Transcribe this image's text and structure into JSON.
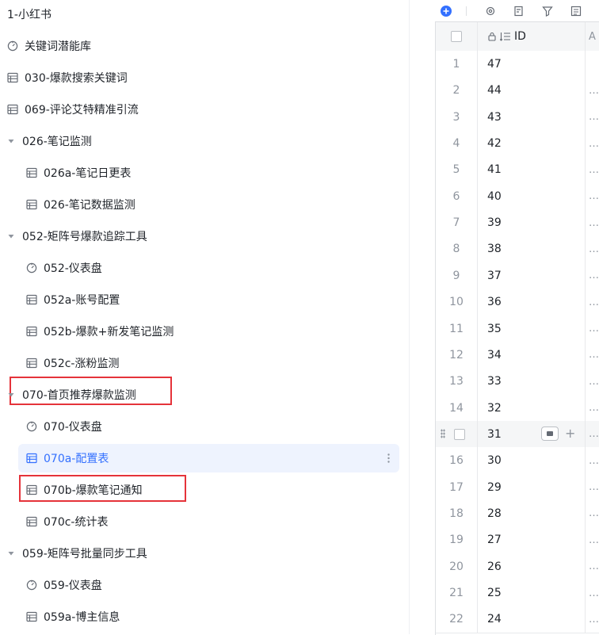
{
  "colors": {
    "accent": "#3370ff",
    "annotation_red": "#e5333a",
    "selected_bg": "#eef3fe"
  },
  "sidebar": {
    "rows": [
      {
        "label": "1-小红书",
        "icon": "none",
        "level": 0
      },
      {
        "label": "关键词潜能库",
        "icon": "dashboard-icon",
        "level": 0
      },
      {
        "label": "030-爆款搜索关键词",
        "icon": "table-icon",
        "level": 0
      },
      {
        "label": "069-评论艾特精准引流",
        "icon": "table-icon",
        "level": 0
      },
      {
        "label": "026-笔记监测",
        "icon": "folder-expanded",
        "level": 0
      },
      {
        "label": "026a-笔记日更表",
        "icon": "table-icon",
        "level": 1
      },
      {
        "label": "026-笔记数据监测",
        "icon": "table-icon",
        "level": 1
      },
      {
        "label": "052-矩阵号爆款追踪工具",
        "icon": "folder-expanded",
        "level": 0
      },
      {
        "label": "052-仪表盘",
        "icon": "dashboard-icon",
        "level": 1
      },
      {
        "label": "052a-账号配置",
        "icon": "table-icon",
        "level": 1
      },
      {
        "label": "052b-爆款+新发笔记监测",
        "icon": "table-icon",
        "level": 1
      },
      {
        "label": "052c-涨粉监测",
        "icon": "table-icon",
        "level": 1
      },
      {
        "label": "070-首页推荐爆款监测",
        "icon": "folder-expanded",
        "level": 0
      },
      {
        "label": "070-仪表盘",
        "icon": "dashboard-icon",
        "level": 1
      },
      {
        "label": "070a-配置表",
        "icon": "table-icon",
        "level": 1,
        "selected": true
      },
      {
        "label": "070b-爆款笔记通知",
        "icon": "table-icon",
        "level": 1
      },
      {
        "label": "070c-统计表",
        "icon": "table-icon",
        "level": 1
      },
      {
        "label": "059-矩阵号批量同步工具",
        "icon": "folder-expanded",
        "level": 0
      },
      {
        "label": "059-仪表盘",
        "icon": "dashboard-icon",
        "level": 1
      },
      {
        "label": "059a-博主信息",
        "icon": "table-icon",
        "level": 1
      }
    ]
  },
  "toolbar": {
    "icons": [
      "add-circle-icon",
      "settings-icon",
      "form-icon",
      "filter-icon",
      "list-icon"
    ]
  },
  "grid": {
    "header": {
      "id_label": "ID",
      "next_col_partial": "A"
    },
    "rows": [
      {
        "index": "1",
        "id": "47",
        "next": ""
      },
      {
        "index": "2",
        "id": "44",
        "next": "…"
      },
      {
        "index": "3",
        "id": "43",
        "next": "…"
      },
      {
        "index": "4",
        "id": "42",
        "next": "…"
      },
      {
        "index": "5",
        "id": "41",
        "next": "…"
      },
      {
        "index": "6",
        "id": "40",
        "next": "…"
      },
      {
        "index": "7",
        "id": "39",
        "next": "…"
      },
      {
        "index": "8",
        "id": "38",
        "next": "…"
      },
      {
        "index": "9",
        "id": "37",
        "next": "…"
      },
      {
        "index": "10",
        "id": "36",
        "next": "…"
      },
      {
        "index": "11",
        "id": "35",
        "next": "…"
      },
      {
        "index": "12",
        "id": "34",
        "next": "…"
      },
      {
        "index": "13",
        "id": "33",
        "next": "…"
      },
      {
        "index": "14",
        "id": "32",
        "next": "…"
      },
      {
        "index": "",
        "id": "31",
        "next": "…",
        "hover": true
      },
      {
        "index": "16",
        "id": "30",
        "next": "…"
      },
      {
        "index": "17",
        "id": "29",
        "next": "…"
      },
      {
        "index": "18",
        "id": "28",
        "next": "…"
      },
      {
        "index": "19",
        "id": "27",
        "next": "…"
      },
      {
        "index": "20",
        "id": "26",
        "next": "…"
      },
      {
        "index": "21",
        "id": "25",
        "next": "…"
      },
      {
        "index": "22",
        "id": "24",
        "next": "…"
      }
    ]
  }
}
